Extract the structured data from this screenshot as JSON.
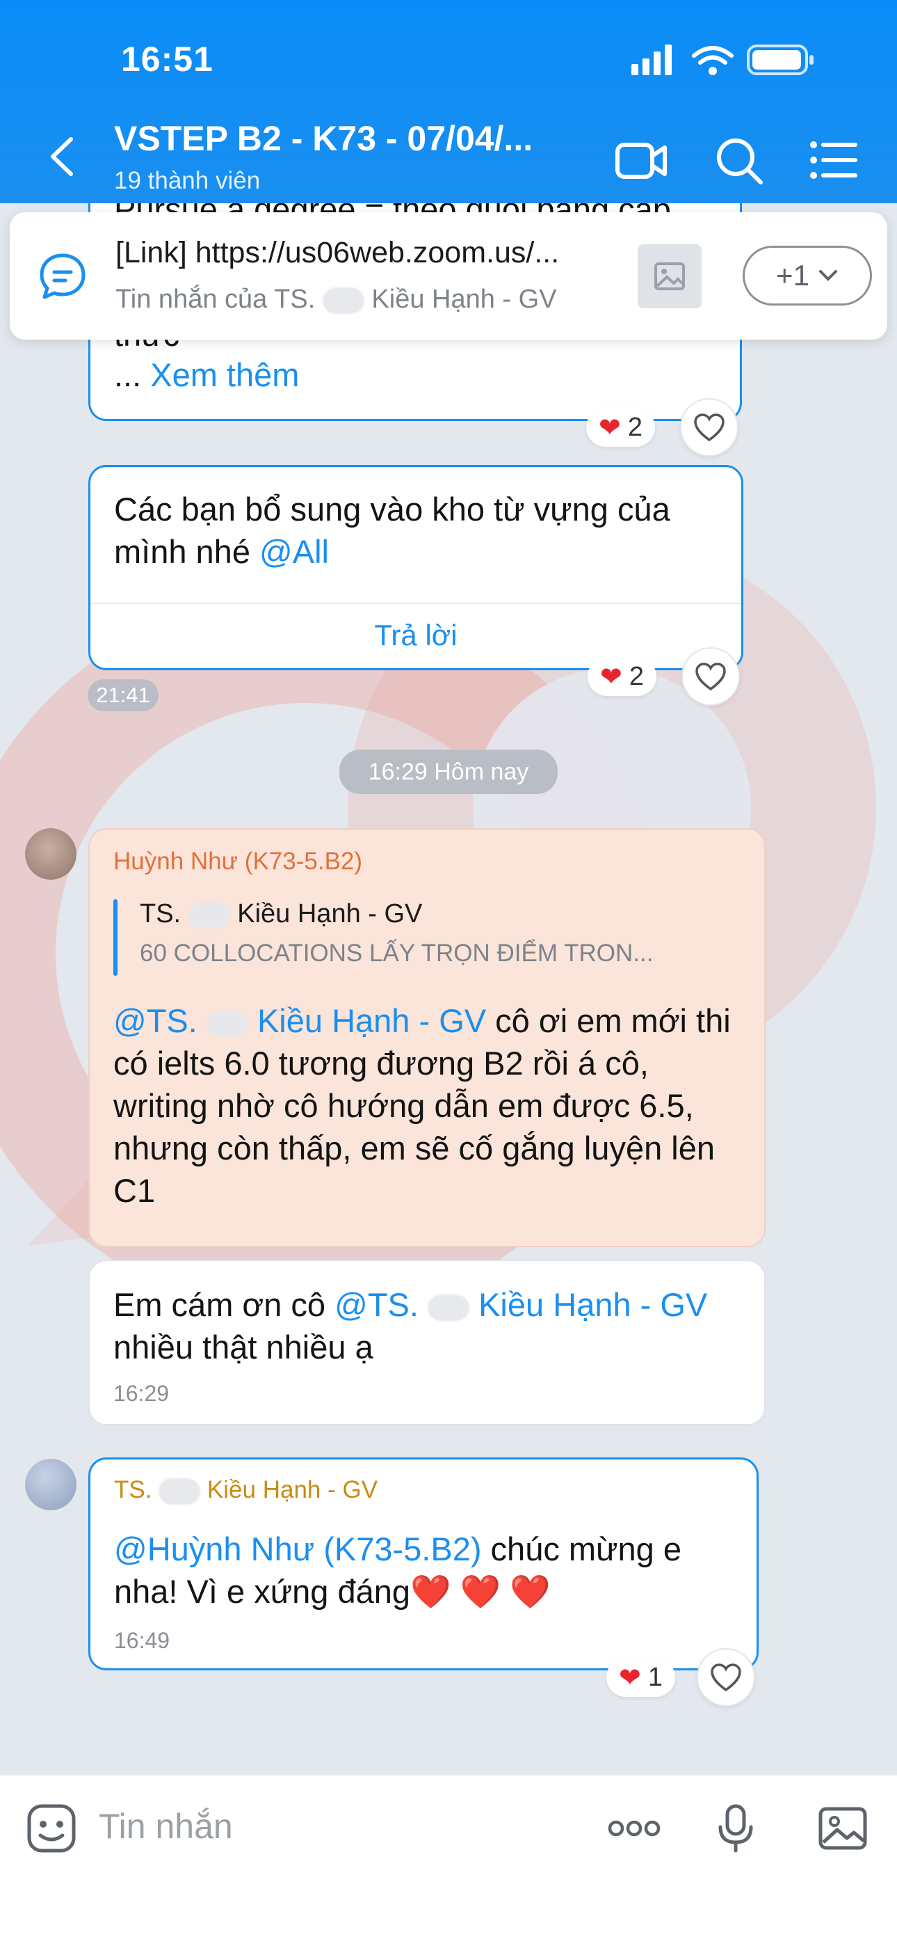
{
  "status": {
    "time": "16:51"
  },
  "header": {
    "title": "VSTEP B2 - K73 - 07/04/...",
    "members": "19 thành viên"
  },
  "pinned": {
    "link": "[Link] https://us06web.zoom.us/...",
    "from_prefix": "Tin nhắn của TS.",
    "from_suffix": "Kiều Hạnh - GV",
    "more": "+1"
  },
  "messages": {
    "top_cut": {
      "line1": "Pursue a degree = theo đuổi bằng cấp",
      "line2": "thức",
      "more_prefix": "... ",
      "more": "Xem thêm",
      "reactions": "2"
    },
    "vocab": {
      "text": "Các bạn bổ sung vào kho từ vựng của mình nhé",
      "mention": "@All",
      "reply": "Trả lời",
      "reactions": "2",
      "time": "21:41"
    },
    "divider": "16:29 Hôm nay",
    "nhu_1": {
      "sender": "Huỳnh Như (K73-5.B2)",
      "quote_author_prefix": "TS.",
      "quote_author_suffix": "Kiều Hạnh - GV",
      "quote_text": "60 COLLOCATIONS LẤY TRỌN ĐIỂM TRON...",
      "mention_prefix": "@TS.",
      "mention_suffix": "Kiều Hạnh - GV",
      "text_line1": " cô ơi em mới",
      "text_rest": "thi có ielts 6.0 tương đương B2 rồi á cô, writing nhờ cô hướng dẫn em được 6.5, nhưng còn thấp, em sẽ cố gắng luyện lên C1"
    },
    "nhu_2": {
      "text_prefix": "Em cám ơn cô ",
      "mention_prefix": "@TS.",
      "mention_suffix": "Kiều Hạnh - GV",
      "text_suffix": "nhiều thật nhiều ạ",
      "time": "16:29"
    },
    "teacher": {
      "sender_prefix": "TS.",
      "sender_suffix": "Kiều Hạnh - GV",
      "mention": "@Huỳnh Như (K73-5.B2)",
      "text": " chúc mừng e nha! Vì e xứng đáng",
      "hearts": "❤️ ❤️ ❤️",
      "time": "16:49",
      "reactions": "1"
    }
  },
  "composer": {
    "placeholder": "Tin nhắn"
  },
  "colors": {
    "brand": "#1a8ff0",
    "sender_orange": "#e3703a",
    "sender_gold": "#c98b12"
  },
  "icons": [
    "back-icon",
    "video-call-icon",
    "search-icon",
    "menu-icon",
    "message-icon",
    "image-icon",
    "heart-icon",
    "like-icon",
    "sticker-icon",
    "more-icon",
    "mic-icon",
    "gallery-icon"
  ]
}
